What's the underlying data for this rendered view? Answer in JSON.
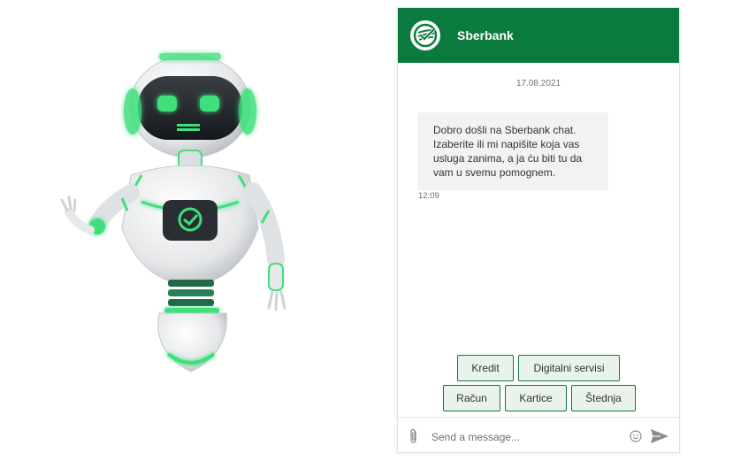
{
  "chat": {
    "brand": "Sberbank",
    "date": "17.08.2021",
    "message": "Dobro došli na Sberbank chat. Izaberite ili mi napišite koja vas usluga zanima, a ja ću biti tu da vam u svemu pomognem.",
    "message_time": "12:09",
    "quick_replies": {
      "kredit": "Kredit",
      "digitalni_servisi": "Digitalni servisi",
      "racun": "Račun",
      "kartice": "Kartice",
      "stednja": "Štednja"
    },
    "input_placeholder": "Send a message..."
  },
  "colors": {
    "brand_green": "#0b7a3e",
    "bubble_bg": "#f2f2f2",
    "chip_bg": "#e9f3ec",
    "robot_glow": "#3de07a"
  },
  "icons": {
    "logo": "sberbank-logo-icon",
    "attach": "paperclip-icon",
    "emoji": "emoji-icon",
    "send": "send-icon"
  }
}
